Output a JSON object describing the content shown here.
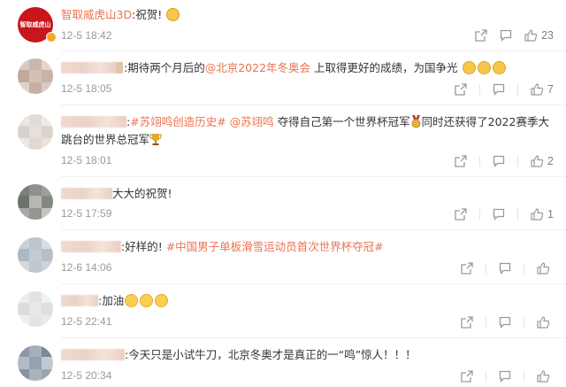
{
  "comments": [
    {
      "author": "智取威虎山3D",
      "avatar_text": "智取威虎山",
      "text": ":祝贺!",
      "emoji": "clap",
      "time": "12-5 18:42",
      "likes": "23",
      "verified": true
    },
    {
      "author_hidden": true,
      "pre": ":期待两个月后的",
      "link": "@北京2022年冬奥会",
      "post": " 上取得更好的成绩，为国争光",
      "emojis": [
        "thumb",
        "thumb",
        "thumb"
      ],
      "time": "12-5 18:05",
      "likes": "7"
    },
    {
      "author_hidden": true,
      "pre": ":",
      "link": "#苏翊鸣创造历史#",
      "link2": " @苏翊鸣",
      "post": " 夺得自己第一个世界杯冠军",
      "post2": "同时还获得了2022赛季大跳台的世界总冠军",
      "time": "12-5 18:01",
      "likes": "2"
    },
    {
      "author_hidden": true,
      "pre": "大大的祝贺!",
      "time": "12-5 17:59",
      "likes": "1"
    },
    {
      "author_hidden": true,
      "pre": ":好样的! ",
      "link": "#中国男子单板滑雪运动员首次世界杯夺冠#",
      "time": "12-6 14:06",
      "likes": ""
    },
    {
      "author_hidden": true,
      "pre": ":加油",
      "emojis": [
        "wow",
        "wow",
        "wow"
      ],
      "time": "12-5 22:41",
      "likes": ""
    },
    {
      "author_hidden": true,
      "pre": ":今天只是小试牛刀，北京冬奥才是真正的一“鸣”惊人！！！",
      "time": "12-5 20:34",
      "likes": ""
    }
  ],
  "icons": {
    "share": "share-icon",
    "comment": "comment-icon",
    "like": "thumbs-up-icon"
  },
  "colors": {
    "link": "#eb7350",
    "time": "#999999",
    "icon": "#9a9a9a",
    "brand": "#c8161d"
  }
}
